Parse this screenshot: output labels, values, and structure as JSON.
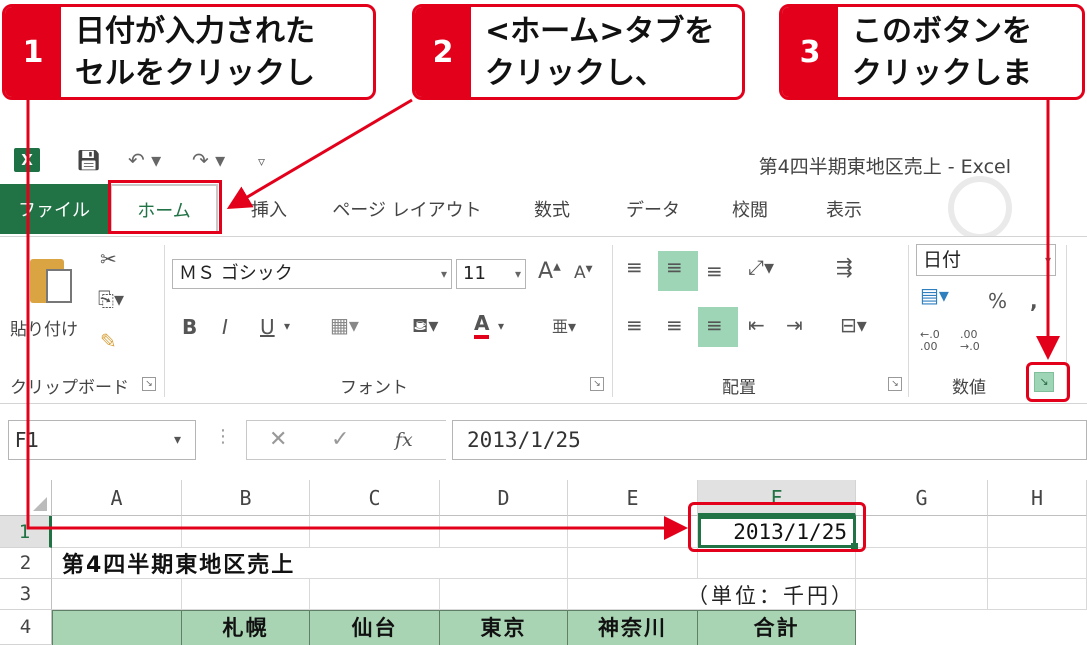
{
  "callouts": [
    {
      "num": "1",
      "text": "日付が入力された\nセルをクリックして、"
    },
    {
      "num": "2",
      "text": "<ホーム>タブを\nクリックし、"
    },
    {
      "num": "3",
      "text": "このボタンを\nクリックします。"
    }
  ],
  "window": {
    "title": "第4四半期東地区売上 - Excel"
  },
  "tabs": [
    "ファイル",
    "ホーム",
    "挿入",
    "ページ レイアウト",
    "数式",
    "データ",
    "校閲",
    "表示"
  ],
  "ribbon": {
    "clipboard": {
      "paste_label": "貼り付け",
      "group_label": "クリップボード"
    },
    "font": {
      "font_name": "ＭＳ ゴシック",
      "font_size": "11",
      "group_label": "フォント",
      "bold": "B",
      "italic": "I",
      "underline": "U",
      "font_color_letter": "A",
      "grow": "A",
      "shrink": "A"
    },
    "alignment": {
      "group_label": "配置"
    },
    "number": {
      "format": "日付",
      "percent": "%",
      "comma": ",",
      "group_label": "数値",
      "dec_inc": "←.0\n.00",
      "dec_dec": ".00\n→.0"
    }
  },
  "formula_bar": {
    "name_box": "F1",
    "fx": "fx",
    "value": "2013/1/25"
  },
  "grid": {
    "columns": [
      "A",
      "B",
      "C",
      "D",
      "E",
      "F",
      "G",
      "H"
    ],
    "rows": [
      "1",
      "2",
      "3",
      "4"
    ],
    "f1_value": "2013/1/25",
    "title": "第4四半期東地区売上",
    "unit": "（単位：千円）",
    "header_row": [
      "",
      "札幌",
      "仙台",
      "東京",
      "神奈川",
      "合計"
    ]
  },
  "colors": {
    "accent_red": "#e3001b",
    "excel_green": "#217346",
    "header_fill": "#a9d4b3"
  }
}
